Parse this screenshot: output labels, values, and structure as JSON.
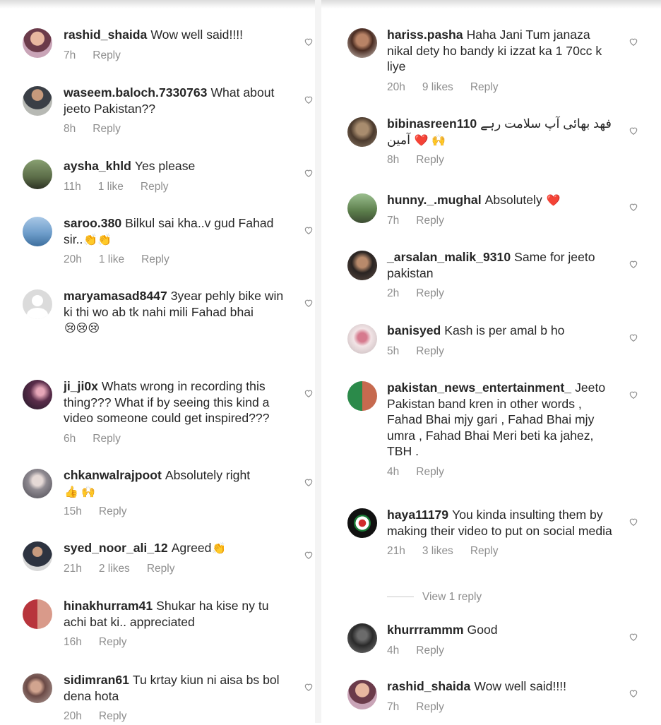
{
  "left_comments": [
    {
      "user": "rashid_shaida",
      "text": "Wow well said!!!!",
      "time": "7h",
      "likes": "",
      "reply": "Reply"
    },
    {
      "user": "waseem.baloch.7330763",
      "text": "What about jeeto Pakistan??",
      "time": "8h",
      "likes": "",
      "reply": "Reply"
    },
    {
      "user": "aysha_khld",
      "text": "Yes please",
      "time": "11h",
      "likes": "1 like",
      "reply": "Reply"
    },
    {
      "user": "saroo.380",
      "text": "Bilkul sai kha..v gud Fahad sir..",
      "time": "20h",
      "likes": "1 like",
      "reply": "Reply",
      "emoji": "👏👏"
    },
    {
      "user": "maryamasad8447",
      "text": "3year pehly bike win ki thi wo ab tk nahi mili Fahad bhai",
      "time": "",
      "likes": "",
      "reply": "",
      "emoji": "😢😢😢"
    },
    {
      "user": "ji_ji0x",
      "text": "Whats wrong in recording this thing??? What if by seeing this kind a video someone could get inspired???",
      "time": "6h",
      "likes": "",
      "reply": "Reply"
    },
    {
      "user": "chkanwalrajpoot",
      "text": "Absolutely right",
      "time": "15h",
      "likes": "",
      "reply": "Reply",
      "emoji": "👍 🙌"
    },
    {
      "user": "syed_noor_ali_12",
      "text": "Agreed",
      "time": "21h",
      "likes": "2 likes",
      "reply": "Reply",
      "emoji": "👏"
    },
    {
      "user": "hinakhurram41",
      "text": "Shukar ha kise ny tu achi bat ki.. appreciated",
      "time": "16h",
      "likes": "",
      "reply": "Reply"
    },
    {
      "user": "sidimran61",
      "text": "Tu krtay kiun ni aisa bs bol dena hota",
      "time": "20h",
      "likes": "",
      "reply": "Reply"
    }
  ],
  "right_comments": [
    {
      "user": "hariss.pasha",
      "text": "Haha Jani Tum janaza nikal dety ho bandy ki izzat ka 1 70cc k liye",
      "time": "20h",
      "likes": "9 likes",
      "reply": "Reply"
    },
    {
      "user": "bibinasreen110",
      "text": "فهد بھائی آپ سلامت رہے آمین",
      "time": "8h",
      "likes": "",
      "reply": "Reply",
      "emoji": "❤️ 🙌"
    },
    {
      "user": "hunny._.mughal",
      "text": "Absolutely",
      "time": "7h",
      "likes": "",
      "reply": "Reply",
      "emoji": "❤️"
    },
    {
      "user": "_arsalan_malik_9310",
      "text": "Same for jeeto pakistan",
      "time": "2h",
      "likes": "",
      "reply": "Reply"
    },
    {
      "user": "banisyed",
      "text": "Kash is per amal b ho",
      "time": "5h",
      "likes": "",
      "reply": "Reply"
    },
    {
      "user": "pakistan_news_entertainment_",
      "text": "Jeeto Pakistan band kren in other words , Fahad Bhai mjy gari , Fahad Bhai mjy umra , Fahad Bhai Meri beti ka jahez, TBH .",
      "time": "4h",
      "likes": "",
      "reply": "Reply"
    },
    {
      "user": "haya11179",
      "text": "You kinda insulting them by making their video to put on social media",
      "time": "21h",
      "likes": "3 likes",
      "reply": "Reply"
    },
    {
      "user": "khurrrammm",
      "text": "Good",
      "time": "4h",
      "likes": "",
      "reply": "Reply"
    },
    {
      "user": "rashid_shaida",
      "text": "Wow well said!!!!",
      "time": "7h",
      "likes": "",
      "reply": "Reply"
    }
  ],
  "view_replies": "View 1 reply",
  "colors": {
    "text": "#262626",
    "meta": "#8e8e8e",
    "accent_heart": "#e0245e"
  }
}
